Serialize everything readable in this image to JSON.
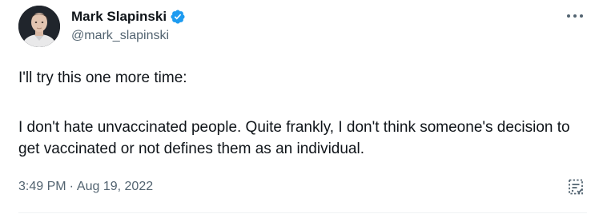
{
  "author": {
    "display_name": "Mark Slapinski",
    "handle": "@mark_slapinski",
    "verified": true,
    "avatar_icon": "profile-photo"
  },
  "tweet": {
    "paragraphs": [
      "I'll try this one more time:",
      "I don't hate unvaccinated people. Quite frankly, I don't think someone's decision to get vaccinated or not defines them as an individual."
    ],
    "time": "3:49 PM",
    "separator": "·",
    "date": "Aug 19, 2022"
  },
  "icons": {
    "verified": "verified-badge-icon",
    "more": "more-options-icon",
    "notes": "notes-icon"
  },
  "colors": {
    "verified": "#1d9bf0",
    "secondary_text": "#536471",
    "primary_text": "#0f1419"
  }
}
